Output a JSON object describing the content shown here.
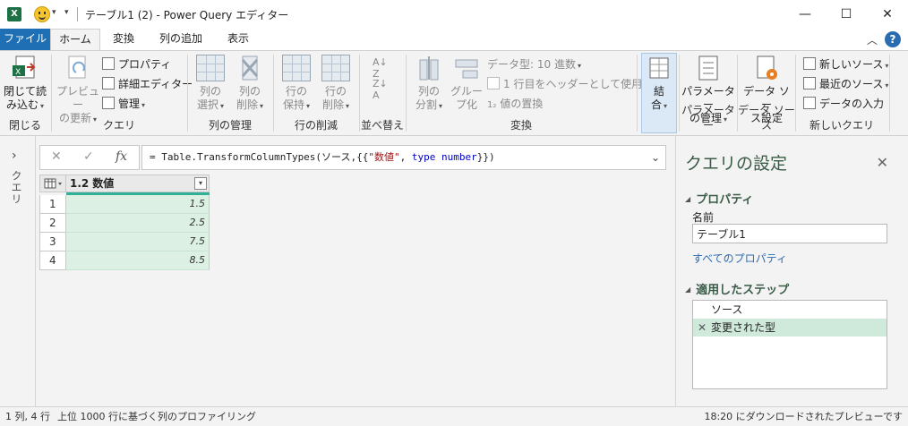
{
  "window": {
    "title": "テーブル1 (2) - Power Query エディター",
    "excel_icon": "X",
    "minimize": "—",
    "maximize": "☐",
    "close": "✕"
  },
  "tabs": {
    "file": "ファイル",
    "home": "ホーム",
    "transform": "変換",
    "add_column": "列の追加",
    "view": "表示",
    "collapse": "︿",
    "help": "?"
  },
  "ribbon": {
    "close_group": {
      "label": "閉じる",
      "close_load": [
        "閉じて読",
        "み込む"
      ]
    },
    "query_group": {
      "label": "クエリ",
      "preview_refresh": [
        "プレビュー",
        "の更新"
      ],
      "properties": "プロパティ",
      "advanced_editor": "詳細エディター",
      "manage": "管理"
    },
    "column_mgmt": {
      "label": "列の管理",
      "choose_columns": [
        "列の",
        "選択"
      ],
      "remove_columns": [
        "列の",
        "削除"
      ]
    },
    "row_reduce": {
      "label": "行の削減",
      "keep_rows": [
        "行の",
        "保持"
      ],
      "remove_rows": [
        "行の",
        "削除"
      ]
    },
    "sort": {
      "label": "並べ替え"
    },
    "transform": {
      "label": "変換",
      "split_column": [
        "列の",
        "分割"
      ],
      "group_by": [
        "グルー",
        "プ化"
      ],
      "data_type": "データ型: 10 進数",
      "use_first_row": "1 行目をヘッダーとして使用",
      "replace_values": "値の置換"
    },
    "combine": {
      "combine": [
        "結",
        "合"
      ]
    },
    "parameters": {
      "label": "パラメーター",
      "manage": [
        "パラメーター",
        "の管理"
      ]
    },
    "data_source": {
      "label": "データ ソース",
      "settings": [
        "データ ソー",
        "ス設定"
      ]
    },
    "new_query": {
      "label": "新しいクエリ",
      "new_source": "新しいソース",
      "recent_sources": "最近のソース",
      "enter_data": "データの入力"
    }
  },
  "queries_pane": {
    "label": "クエリ",
    "expand": "›"
  },
  "formula_bar": {
    "cancel": "✕",
    "commit": "✓",
    "fx": "fx",
    "prefix": "= Table.TransformColumnTypes(ソース,{{",
    "string": "\"数値\"",
    "sep": ", ",
    "keyword": "type",
    "space": " ",
    "type_name": "number",
    "suffix": "}})",
    "dropdown": "⌄"
  },
  "grid": {
    "column": {
      "type_label": "1.2",
      "name": "数値"
    },
    "rows": [
      {
        "index": "1",
        "value": "1.5"
      },
      {
        "index": "2",
        "value": "2.5"
      },
      {
        "index": "3",
        "value": "7.5"
      },
      {
        "index": "4",
        "value": "8.5"
      }
    ]
  },
  "settings": {
    "title": "クエリの設定",
    "close": "✕",
    "properties_section": "プロパティ",
    "name_label": "名前",
    "name_value": "テーブル1",
    "all_properties": "すべてのプロパティ",
    "steps_section": "適用したステップ",
    "steps": [
      {
        "label": "ソース"
      },
      {
        "label": "変更された型",
        "delete": "✕"
      }
    ]
  },
  "status": {
    "size": "1 列, 4 行",
    "profiling": "上位 1000 行に基づく列のプロファイリング",
    "preview": "18:20 にダウンロードされたプレビューです"
  },
  "colors": {
    "file_tab": "#1f6fb5",
    "accent_green": "#3a5c46",
    "column_quality": "#30b098",
    "selected_step": "#cfe9db",
    "link": "#2b6cb0"
  }
}
